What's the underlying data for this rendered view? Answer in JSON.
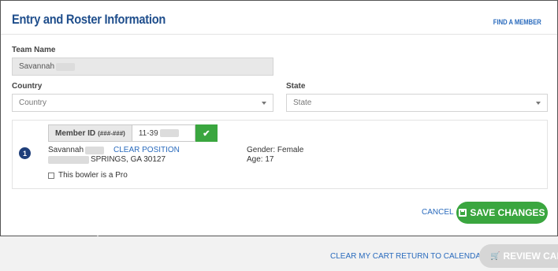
{
  "header": {
    "title": "Entry and Roster Information",
    "find_member": "FIND A MEMBER"
  },
  "form": {
    "team_name_label": "Team Name",
    "team_name_value": "Savannah",
    "country_label": "Country",
    "country_placeholder": "Country",
    "state_label": "State",
    "state_placeholder": "State"
  },
  "roster": {
    "position_number": "1",
    "member_id_label": "Member ID",
    "member_id_format": "(###-###)",
    "member_id_value": "11-39",
    "member_name": "Savannah",
    "clear_position": "CLEAR POSITION",
    "address_city": "SPRINGS, GA 30127",
    "gender": "Gender: Female",
    "age": "Age: 17",
    "pro_label": "This bowler is a Pro",
    "pro_checked": false
  },
  "actions": {
    "cancel": "CANCEL",
    "save": "SAVE CHANGES"
  },
  "footer": {
    "clear_cart": "CLEAR MY CART",
    "return_calendar": "RETURN TO CALENDAR",
    "review_cart": "REVIEW CART"
  },
  "colors": {
    "title_blue": "#1f4e8c",
    "link_blue": "#2a6bbd",
    "success_green": "#3aa63f",
    "disabled_gray": "#d6d6d6"
  }
}
